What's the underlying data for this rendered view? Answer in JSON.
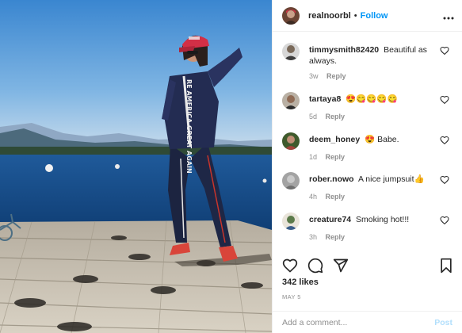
{
  "post": {
    "username": "realnoorbl",
    "separator": "•",
    "follow_label": "Follow",
    "more_label": "•••",
    "photo_caption_text": "RE AMERICA GREAT AGAIN"
  },
  "comments": [
    {
      "username": "timmysmith82420",
      "text": "Beautiful as always.",
      "time": "3w",
      "reply_label": "Reply"
    },
    {
      "username": "tartaya8",
      "text": "😍😋😋😋😋",
      "time": "5d",
      "reply_label": "Reply"
    },
    {
      "username": "deem_honey",
      "text": "😍 Babe.",
      "time": "1d",
      "reply_label": "Reply"
    },
    {
      "username": "rober.nowo",
      "text": "A nice jumpsuit👍",
      "time": "4h",
      "reply_label": "Reply"
    },
    {
      "username": "creature74",
      "text": "Smoking hot!!!",
      "time": "3h",
      "reply_label": "Reply"
    }
  ],
  "stats": {
    "likes": "342 likes",
    "date": "MAY 5"
  },
  "add_comment": {
    "placeholder": "Add a comment...",
    "post_label": "Post"
  },
  "icons": {
    "like": "heart-icon",
    "comment": "comment-icon",
    "share": "share-icon",
    "save": "bookmark-icon",
    "more": "more-options-icon"
  },
  "colors": {
    "follow": "#0095f6",
    "post_disabled": "#b2dffc",
    "muted_text": "#8e8e8e",
    "divider": "#efefef"
  }
}
